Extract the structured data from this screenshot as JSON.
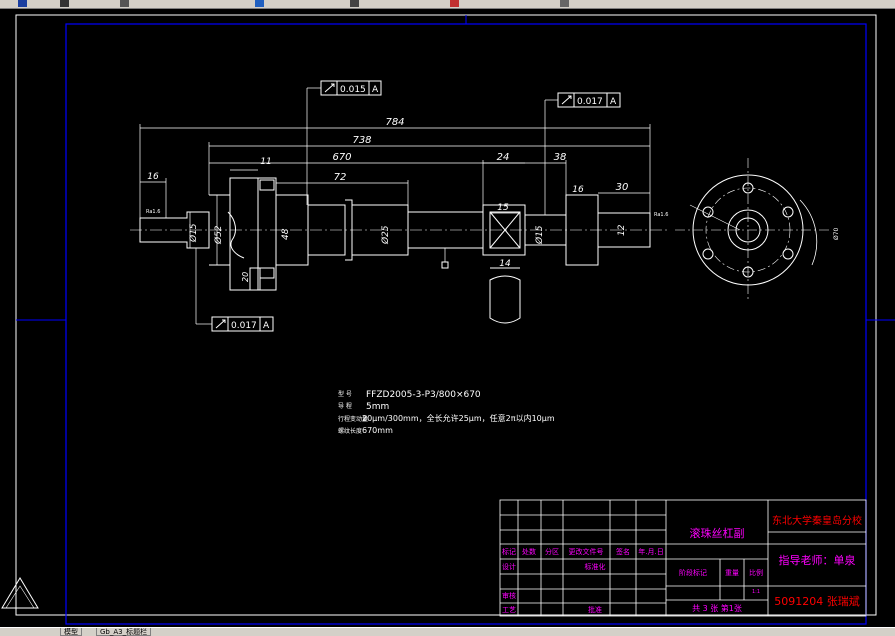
{
  "drawing": {
    "dims": {
      "total_length": "784",
      "length_738": "738",
      "length_670": "670",
      "length_72": "72",
      "length_11": "11",
      "length_24": "24",
      "length_38": "38",
      "length_16_left": "16",
      "length_16_right": "16",
      "length_30": "30",
      "length_15": "15",
      "length_14": "14",
      "length_20": "20",
      "length_48": "48",
      "dia_15_left": "Ø15",
      "dia_52": "Ø52",
      "dia_25": "Ø25",
      "dia_15_right": "Ø15",
      "dia_12": "12",
      "dia_flange": "Ø70",
      "ra_left": "Ra1.6",
      "ra_right": "Ra1.6"
    },
    "tolerances": {
      "runout_top": "0.015",
      "runout_right": "0.017",
      "runout_bottom": "0.017",
      "datum": "A"
    },
    "specs": [
      {
        "label": "型    号",
        "value": "FFZD2005-3-P3/800×670"
      },
      {
        "label": "导    程",
        "value": "5mm"
      },
      {
        "label": "行程变动量",
        "value": "20μm/300mm，全长允许25μm，任意2π以内10μm"
      },
      {
        "label": "螺纹长度",
        "value": "670mm"
      }
    ]
  },
  "title_block": {
    "drawing_name": "滚珠丝杠副",
    "school": "东北大学秦皇岛分校",
    "instructor": "指导老师：单泉",
    "student": "5091204 张瑞斌",
    "sheets": "共 3 张  第1张",
    "scale_value": "1:1",
    "cells": {
      "mark": "标记",
      "count": "处数",
      "zone": "分区",
      "change_doc": "更改文件号",
      "signature": "签名",
      "date": "年.月.日",
      "design": "设计",
      "standardize": "标准化",
      "stage_mark": "阶段标记",
      "weight": "重量",
      "scale": "比例",
      "review": "审核",
      "process": "工艺",
      "approve": "批准"
    }
  },
  "tabs": [
    "模型",
    "Gb_A3_标题栏"
  ],
  "colors": {
    "background": "#000000",
    "frame": "#0000ff",
    "line": "#ffffff",
    "dimension": "#ffffff",
    "title_text": "#ff00ff",
    "school_text": "#ff0000",
    "leader": "#ff00ff",
    "table_line": "#ffffff"
  }
}
